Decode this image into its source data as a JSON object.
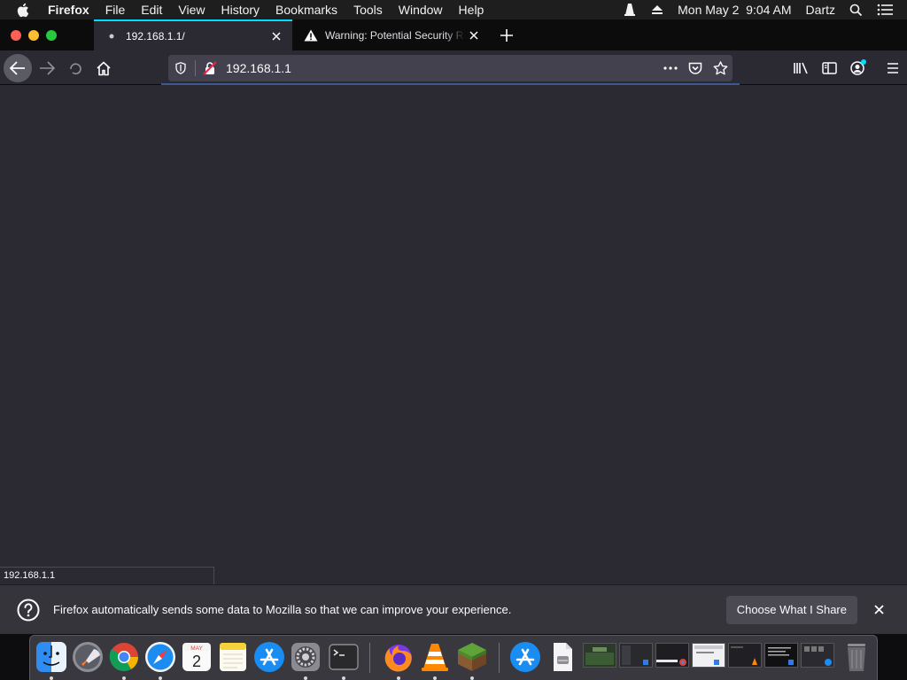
{
  "menubar": {
    "app_name": "Firefox",
    "menus": [
      "File",
      "Edit",
      "View",
      "History",
      "Bookmarks",
      "Tools",
      "Window",
      "Help"
    ],
    "clock": "Mon May 2  9:04 AM",
    "user": "Dartz"
  },
  "tabs": [
    {
      "title": "192.168.1.1/",
      "active": true
    },
    {
      "title": "Warning: Potential Security Risk Ahead",
      "active": false
    }
  ],
  "urlbar": {
    "value": "192.168.1.1"
  },
  "status_popup": "192.168.1.1",
  "notification": {
    "message": "Firefox automatically sends some data to Mozilla so that we can improve your experience.",
    "button": "Choose What I Share"
  },
  "dock": {
    "calendar_month": "MAY",
    "calendar_day": "2"
  },
  "colors": {
    "accent": "#00ddff",
    "content_bg": "#2b2a33",
    "tab_strip_bg": "#0c0c0d"
  }
}
